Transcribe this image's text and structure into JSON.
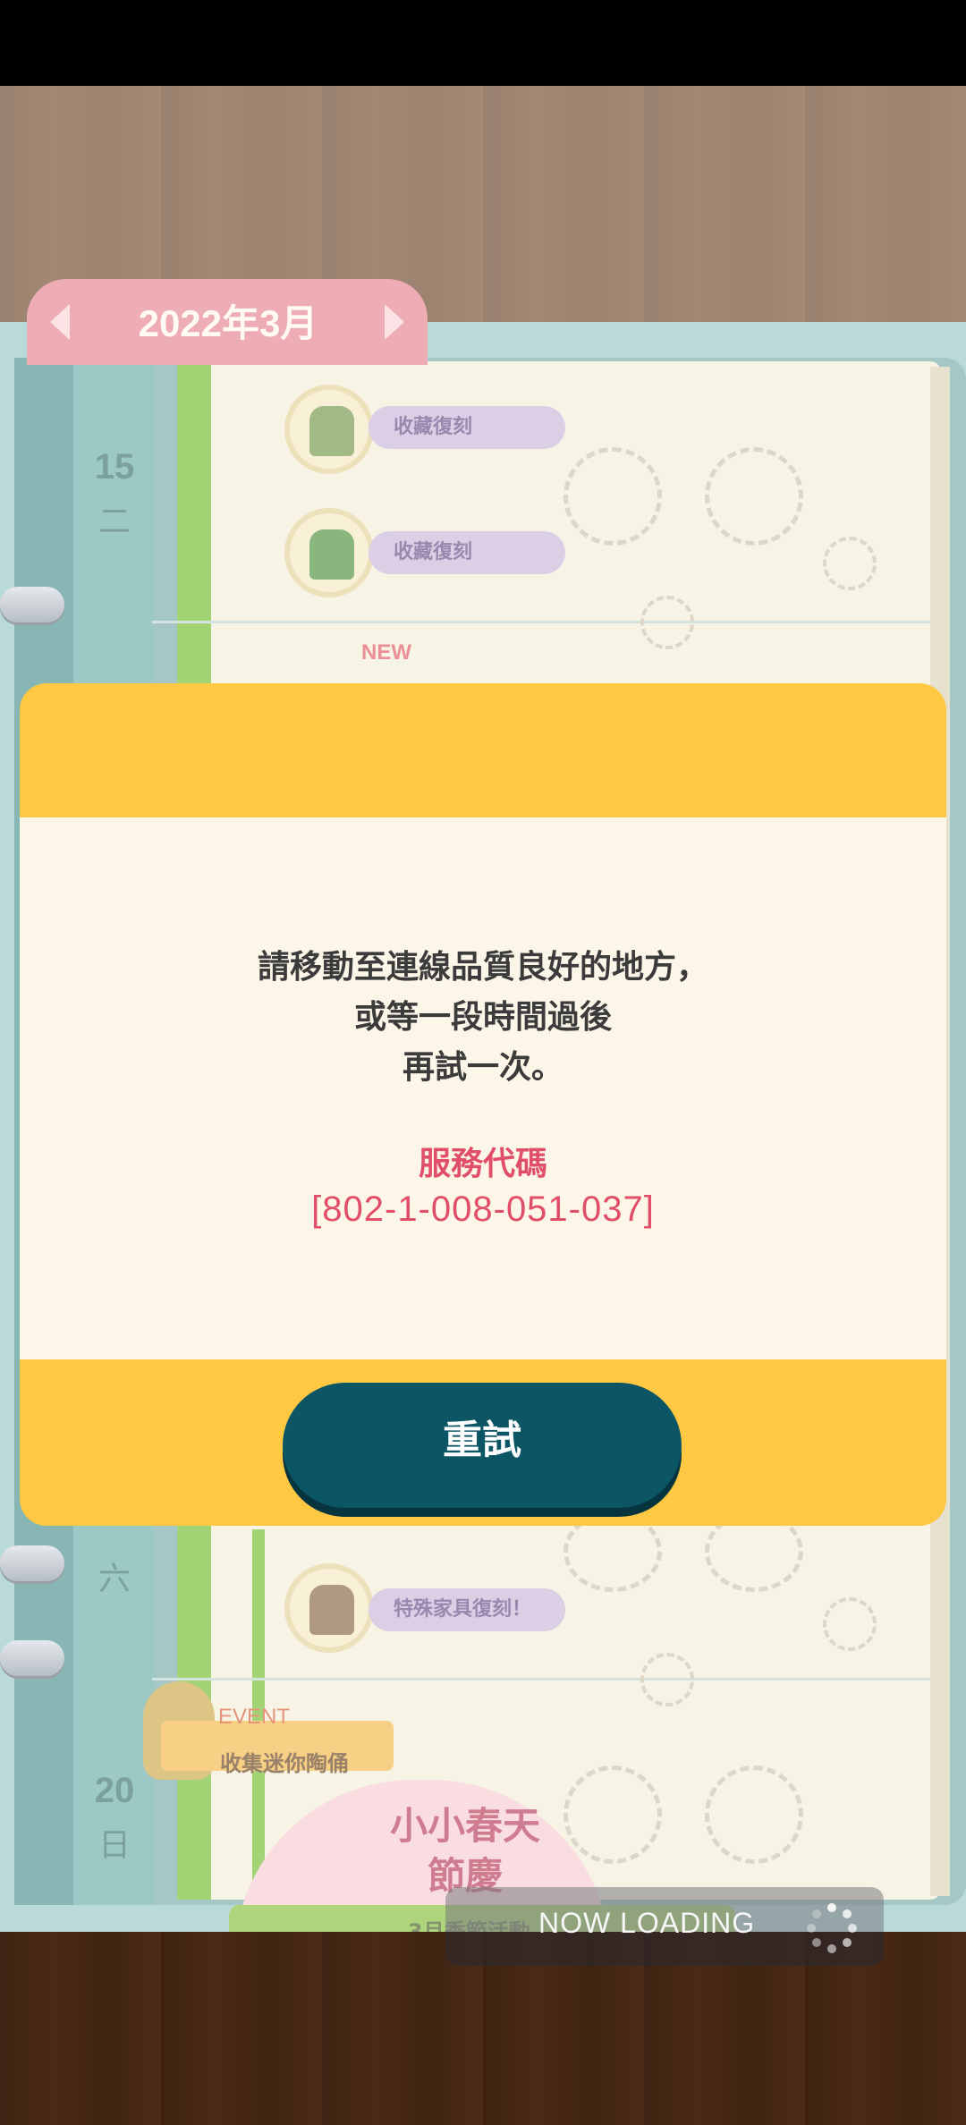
{
  "calendar": {
    "month_label": "2022年3月",
    "days": [
      {
        "num": "15",
        "week": "二"
      },
      {
        "num": "",
        "week": "六"
      },
      {
        "num": "20",
        "week": "日"
      }
    ],
    "events": [
      {
        "label": "收藏復刻"
      },
      {
        "label": "收藏復刻"
      },
      {
        "label": "特殊家具復刻！"
      }
    ],
    "new_tag": "NEW",
    "event_tag": "EVENT",
    "event_banner": "收集迷你陶俑",
    "season_title_line1": "小小春天",
    "season_title_line2": "節慶",
    "season_sub": "3月季節活動"
  },
  "loading": {
    "text": "NOW LOADING"
  },
  "dialog": {
    "message_line1": "請移動至連線品質良好的地方，",
    "message_line2": "或等一段時間過後",
    "message_line3": "再試一次。",
    "code_title": "服務代碼",
    "code_value": "[802-1-008-051-037]",
    "retry_label": "重試"
  },
  "colors": {
    "dialog_yellow": "#fec842",
    "dialog_body": "#fbf6e8",
    "button_teal": "#0b5565",
    "code_pink": "#e04e69"
  }
}
